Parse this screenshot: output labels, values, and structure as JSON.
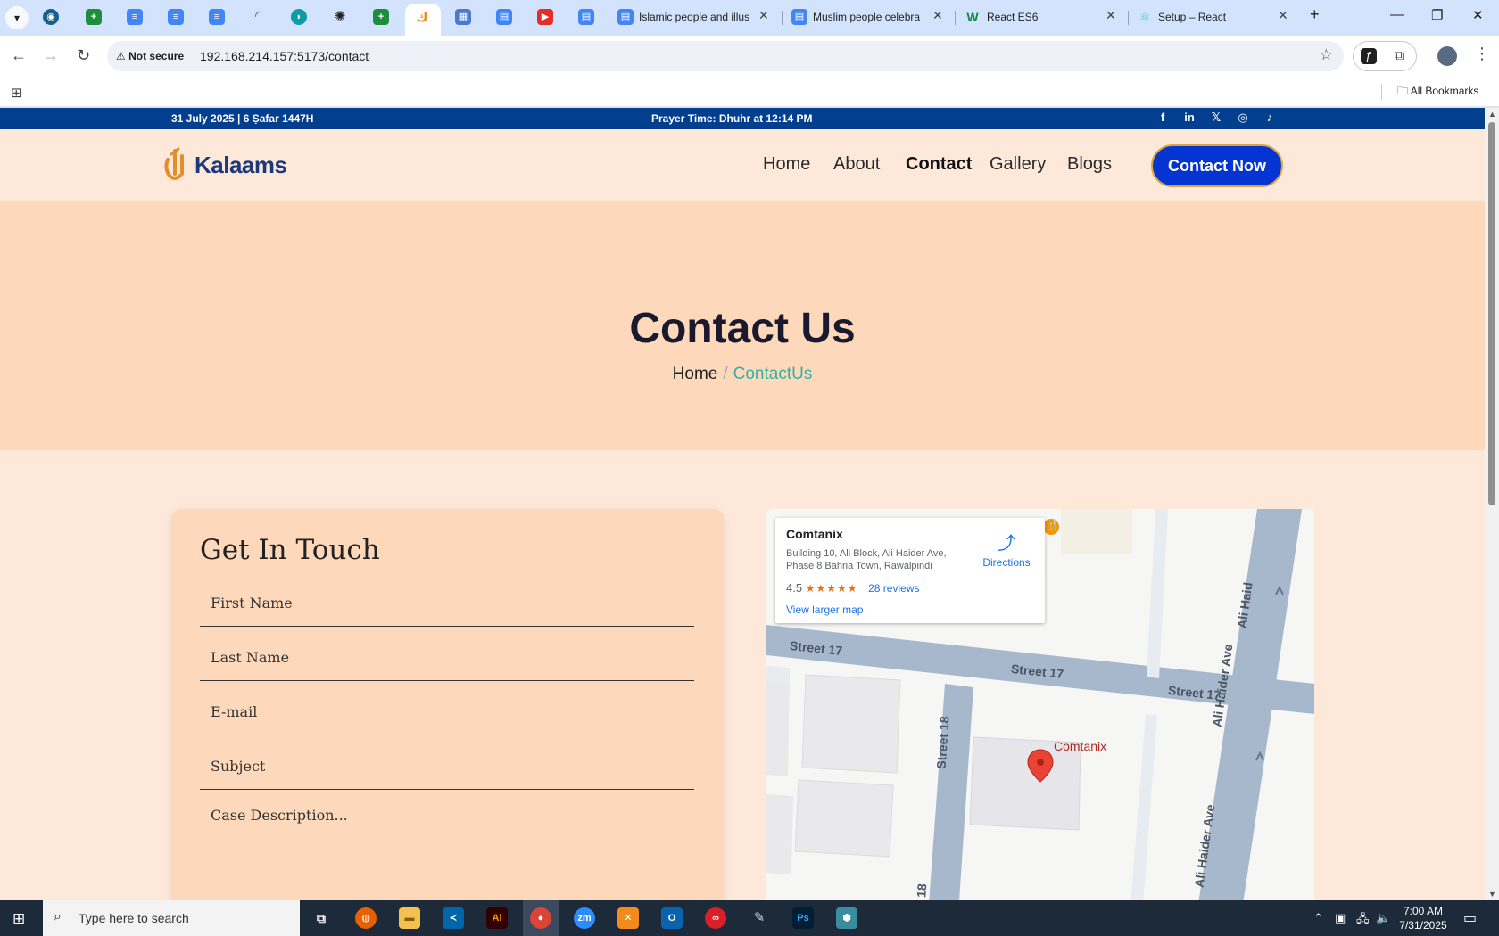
{
  "browser": {
    "tabs": [
      {
        "title": "Islamic people and illus"
      },
      {
        "title": "Muslim people celebra"
      },
      {
        "title": "React ES6"
      },
      {
        "title": "Setup – React"
      }
    ],
    "new_tab": "+",
    "security_label": "Not secure",
    "url": "192.168.214.157:5173/contact",
    "all_bookmarks": "All Bookmarks"
  },
  "topbar": {
    "date": "31 July 2025 | 6 Ṣafar 1447H",
    "prayer_prefix": "Prayer Time: ",
    "prayer_name": "Dhuhr",
    "prayer_suffix": " at 12:14 PM"
  },
  "header": {
    "logo_text": "Kalaams",
    "nav": [
      {
        "label": "Home"
      },
      {
        "label": "About"
      },
      {
        "label": "Contact",
        "active": true
      },
      {
        "label": "Gallery"
      },
      {
        "label": "Blogs"
      }
    ],
    "cta": "Contact Now"
  },
  "hero": {
    "title": "Contact Us",
    "crumb_home": "Home",
    "crumb_sep": "/",
    "crumb_current": "ContactUs"
  },
  "form": {
    "title": "Get In Touch",
    "fields": [
      {
        "placeholder": "First Name"
      },
      {
        "placeholder": "Last Name"
      },
      {
        "placeholder": "E-mail"
      },
      {
        "placeholder": "Subject"
      }
    ],
    "description_placeholder": "Case Description..."
  },
  "map": {
    "place_name": "Comtanix",
    "address": "Building 10, Ali Block, Ali Haider Ave, Phase 8 Bahria Town, Rawalpindi",
    "rating": "4.5",
    "stars": "★★★★★",
    "reviews": "28 reviews",
    "directions": "Directions",
    "larger_map": "View larger map",
    "pin_label": "Comtanix",
    "streets": {
      "s17_a": "Street 17",
      "s17_b": "Street 17",
      "s17_c": "Street 17",
      "s18_a": "Street 18",
      "s18_b": "18",
      "ali_a": "Ali Haider Ave",
      "ali_b": "Ali Haider Ave",
      "ali_c": "Ali Haid"
    }
  },
  "taskbar": {
    "search_placeholder": "Type here to search",
    "time": "7:00 AM",
    "date": "7/31/2025"
  },
  "colors": {
    "topbar": "#023f8f",
    "header_bg": "#fde8da",
    "hero_bg": "#fdd8bb",
    "cta_bg": "#0435d3",
    "breadcrumb_current": "#2fb3a1"
  }
}
